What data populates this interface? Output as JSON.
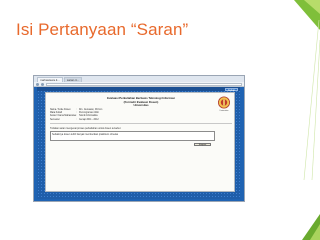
{
  "slide": {
    "title": "Isi Pertanyaan “Saran”",
    "accent_color": "#e8692c"
  },
  "browser": {
    "tabs": [
      "mahasiswa.it...",
      "saran.it..."
    ],
    "logout_label": "Keluar"
  },
  "form": {
    "title_lines": [
      "Evaluasi Perkuliahan Berbasis Teknologi Informasi",
      "(Formulir Evaluasi Dosen)",
      "Universitas"
    ],
    "crest_caption": "Universitas",
    "info": [
      {
        "label": "Nama / Kode Dosen",
        "value": "Drs. Gunawan, M.Kom"
      },
      {
        "label": "Mata Kuliah",
        "value": "Pemrograman Web"
      },
      {
        "label": "Kelas / Nama Mahasiswa",
        "value": "Teknik Informatika"
      },
      {
        "label": "Semester",
        "value": "Genap 2011 - 2012"
      }
    ],
    "question": "Tuliskan saran mengenai proses perkuliahan untuk dosen tersebut",
    "answer_value": "Sebaiknya dosen lebih banyak memberikan praktikum di kelas",
    "submit_label": "Simpan"
  }
}
